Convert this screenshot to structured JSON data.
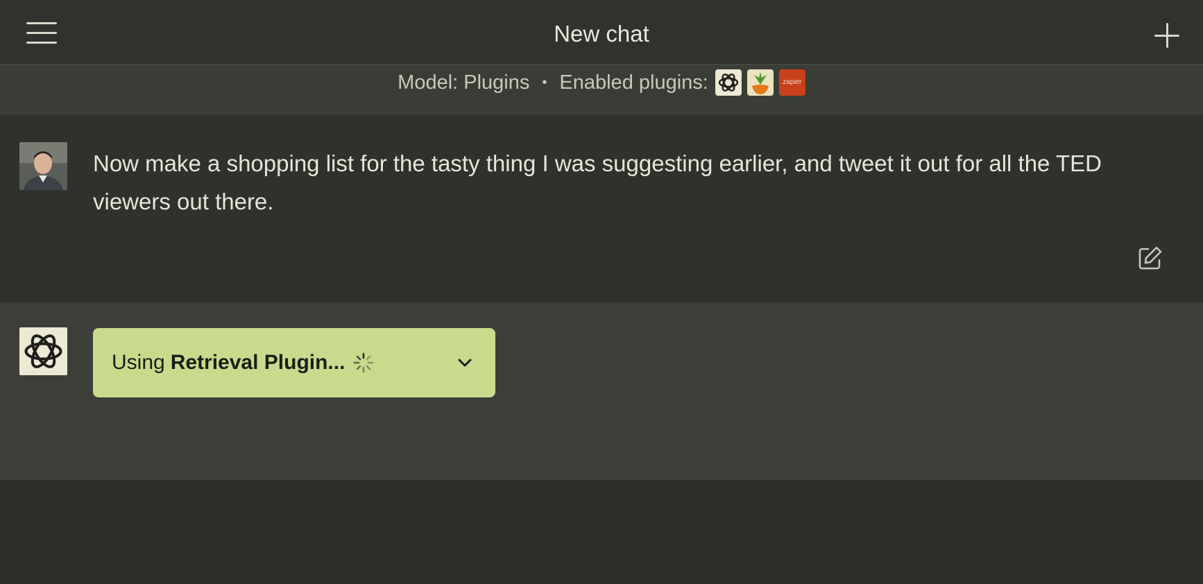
{
  "header": {
    "title": "New chat",
    "menu_icon": "hamburger-menu-icon",
    "new_icon": "plus-icon"
  },
  "model_bar": {
    "model_label": "Model: Plugins",
    "separator": "•",
    "plugins_label": "Enabled plugins:",
    "plugins": [
      {
        "name": "openai-plugin-icon"
      },
      {
        "name": "instacart-plugin-icon"
      },
      {
        "name": "zapier-plugin-icon",
        "text": "zapier"
      }
    ]
  },
  "messages": {
    "user": {
      "text": "Now make a shopping list for the tasty thing I was suggesting earlier, and tweet it out for all the TED viewers out there.",
      "edit_icon": "edit-icon"
    },
    "assistant": {
      "status_prefix": "Using",
      "status_plugin": "Retrieval Plugin...",
      "spinner_icon": "spinner-icon",
      "expand_icon": "chevron-down-icon"
    }
  },
  "colors": {
    "background": "#2c2e29",
    "plugin_pill": "#c8db8d",
    "zapier": "#c8401a"
  }
}
